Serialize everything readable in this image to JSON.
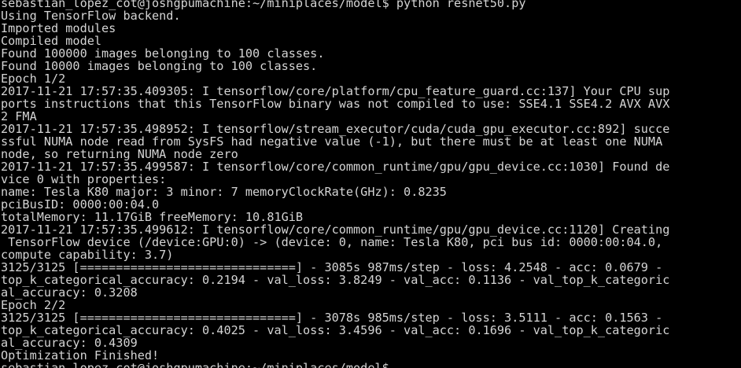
{
  "terminal": {
    "lines": [
      "sebastian_lopez_cot@joshgpumachine:~/miniplaces/model$ python resnet50.py",
      "Using TensorFlow backend.",
      "Imported modules",
      "Compiled model",
      "Found 100000 images belonging to 100 classes.",
      "Found 10000 images belonging to 100 classes.",
      "Epoch 1/2",
      "2017-11-21 17:57:35.409305: I tensorflow/core/platform/cpu_feature_guard.cc:137] Your CPU sup",
      "ports instructions that this TensorFlow binary was not compiled to use: SSE4.1 SSE4.2 AVX AVX",
      "2 FMA",
      "2017-11-21 17:57:35.498952: I tensorflow/stream_executor/cuda/cuda_gpu_executor.cc:892] succe",
      "ssful NUMA node read from SysFS had negative value (-1), but there must be at least one NUMA",
      "node, so returning NUMA node zero",
      "2017-11-21 17:57:35.499587: I tensorflow/core/common_runtime/gpu/gpu_device.cc:1030] Found de",
      "vice 0 with properties:",
      "name: Tesla K80 major: 3 minor: 7 memoryClockRate(GHz): 0.8235",
      "pciBusID: 0000:00:04.0",
      "totalMemory: 11.17GiB freeMemory: 10.81GiB",
      "2017-11-21 17:57:35.499612: I tensorflow/core/common_runtime/gpu/gpu_device.cc:1120] Creating",
      " TensorFlow device (/device:GPU:0) -> (device: 0, name: Tesla K80, pci bus id: 0000:00:04.0,",
      "compute capability: 3.7)",
      "3125/3125 [==============================] - 3085s 987ms/step - loss: 4.2548 - acc: 0.0679 -",
      "top_k_categorical_accuracy: 0.2194 - val_loss: 3.8249 - val_acc: 0.1136 - val_top_k_categoric",
      "al_accuracy: 0.3208",
      "Epoch 2/2",
      "3125/3125 [==============================] - 3078s 985ms/step - loss: 3.5111 - acc: 0.1563 -",
      "top_k_categorical_accuracy: 0.4025 - val_loss: 3.4596 - val_acc: 0.1696 - val_top_k_categoric",
      "al_accuracy: 0.4309",
      "Optimization Finished!",
      "sebastian_lopez_cot@joshgpumachine:~/miniplaces/model$ "
    ]
  }
}
